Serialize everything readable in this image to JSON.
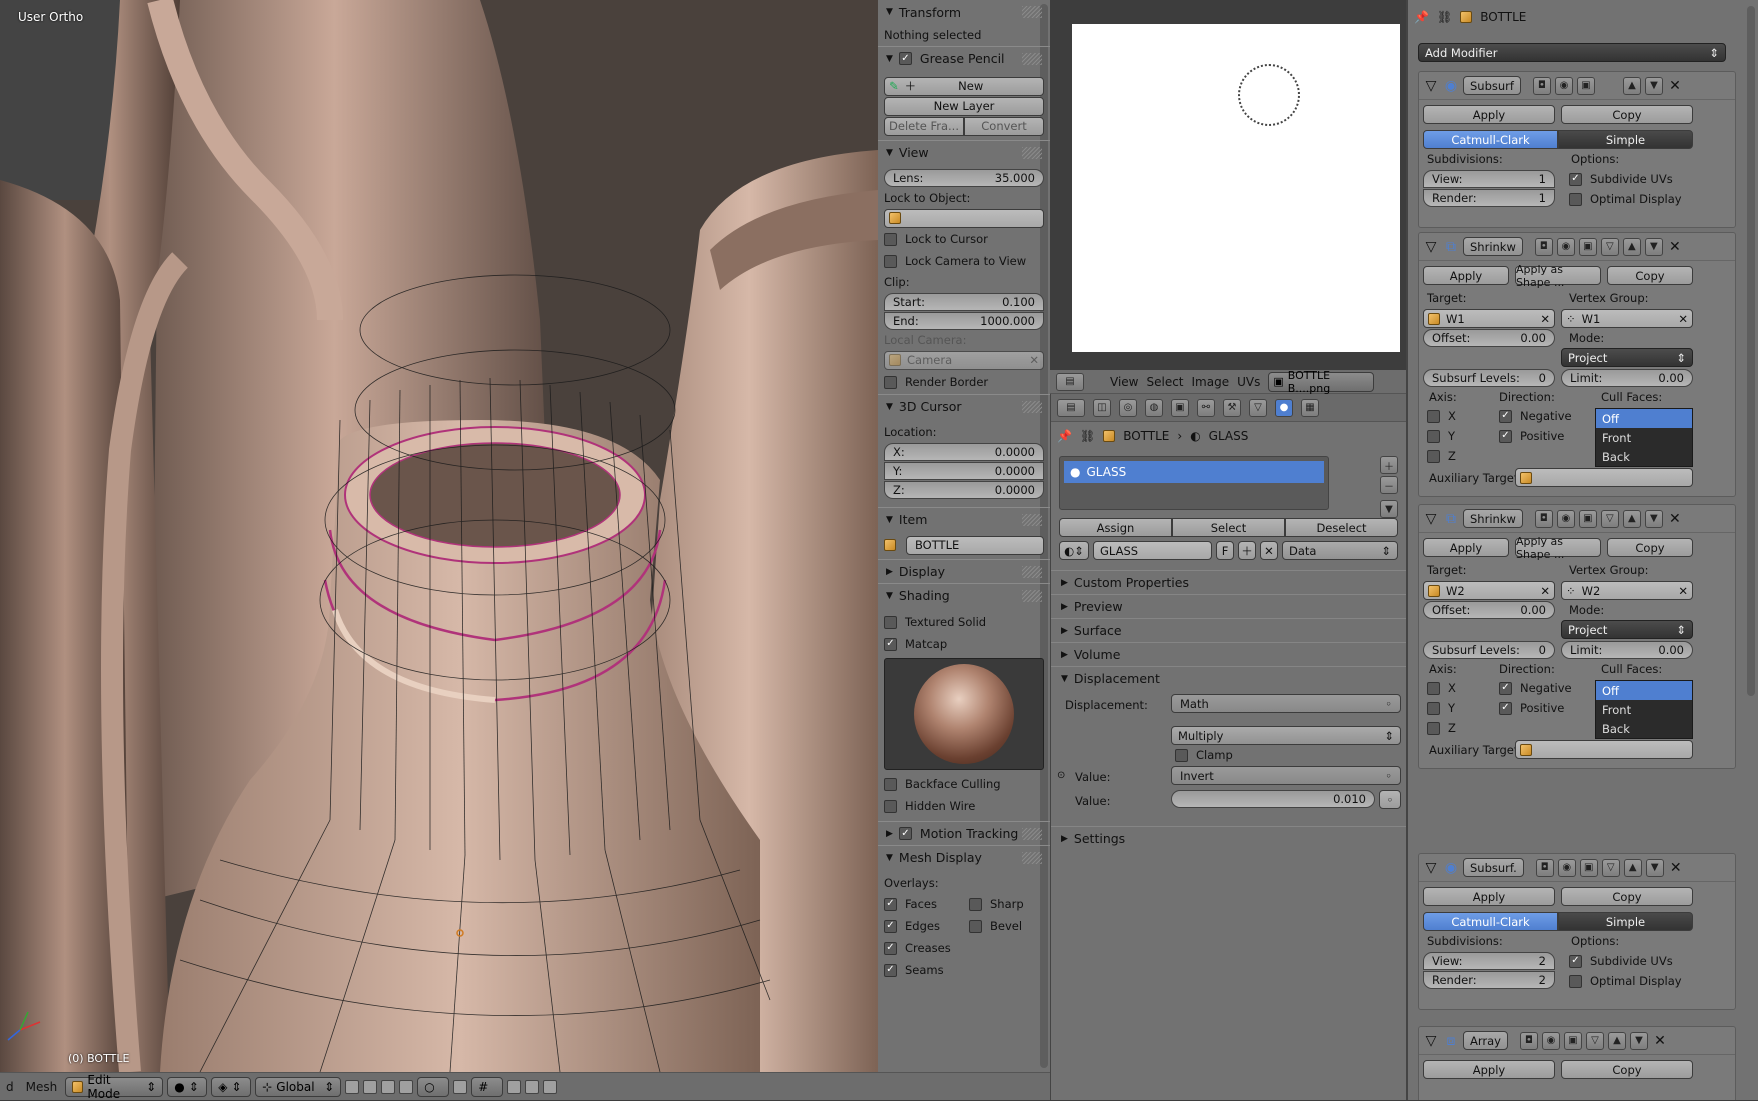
{
  "viewport": {
    "view_label": "User Ortho",
    "object_label": "(0) BOTTLE"
  },
  "header3d": {
    "cut_label": "d",
    "mesh_menu": "Mesh",
    "mode": "Edit Mode",
    "orientation": "Global"
  },
  "npanel": {
    "transform": "Transform",
    "nothing_selected": "Nothing selected",
    "grease_pencil": "Grease Pencil",
    "gp_new": "New",
    "gp_new_layer": "New Layer",
    "gp_delete_frame": "Delete Fra...",
    "gp_convert": "Convert",
    "view": "View",
    "lens_label": "Lens:",
    "lens_value": "35.000",
    "lock_to_object": "Lock to Object:",
    "lock_to_cursor": "Lock to Cursor",
    "lock_camera": "Lock Camera to View",
    "clip": "Clip:",
    "clip_start_label": "Start:",
    "clip_start": "0.100",
    "clip_end_label": "End:",
    "clip_end": "1000.000",
    "local_camera": "Local Camera:",
    "camera": "Camera",
    "render_border": "Render Border",
    "cursor3d": "3D Cursor",
    "location": "Location:",
    "x_label": "X:",
    "x": "0.0000",
    "y_label": "Y:",
    "y": "0.0000",
    "z_label": "Z:",
    "z": "0.0000",
    "item": "Item",
    "item_name": "BOTTLE",
    "display": "Display",
    "shading": "Shading",
    "textured_solid": "Textured Solid",
    "matcap": "Matcap",
    "backface_culling": "Backface Culling",
    "hidden_wire": "Hidden Wire",
    "motion_tracking": "Motion Tracking",
    "mesh_display": "Mesh Display",
    "overlays": "Overlays:",
    "faces": "Faces",
    "sharp": "Sharp",
    "edges": "Edges",
    "bevel": "Bevel",
    "creases": "Creases",
    "seams": "Seams"
  },
  "image_editor": {
    "menu": [
      "View",
      "Select",
      "Image",
      "UVs"
    ],
    "image_name": "BOTTLE B....png"
  },
  "material": {
    "crumb_object": "BOTTLE",
    "crumb_material": "GLASS",
    "slot_name": "GLASS",
    "assign": "Assign",
    "select": "Select",
    "deselect": "Deselect",
    "mat_name": "GLASS",
    "f_label": "F",
    "link": "Data",
    "sections": [
      "Custom Properties",
      "Preview",
      "Surface",
      "Volume"
    ],
    "displacement": "Displacement",
    "disp_label": "Displacement:",
    "disp_node": "Math",
    "operation": "Multiply",
    "clamp": "Clamp",
    "value1_label": "Value:",
    "value1": "Invert",
    "value2_label": "Value:",
    "value2": "0.010",
    "settings": "Settings"
  },
  "modifiers": {
    "crumb": "BOTTLE",
    "add_modifier": "Add Modifier",
    "apply": "Apply",
    "copy": "Copy",
    "apply_as_shape": "Apply as Shape ...",
    "catmull": "Catmull-Clark",
    "simple": "Simple",
    "subdivisions": "Subdivisions:",
    "options": "Options:",
    "view_label": "View:",
    "render_label": "Render:",
    "subdivide_uvs": "Subdivide UVs",
    "optimal_display": "Optimal Display",
    "target": "Target:",
    "vertex_group": "Vertex Group:",
    "offset_label": "Offset:",
    "mode": "Mode:",
    "project": "Project",
    "subsurf_levels": "Subsurf Levels:",
    "limit_label": "Limit:",
    "axis": "Axis:",
    "direction": "Direction:",
    "cull_faces": "Cull Faces:",
    "x": "X",
    "y": "Y",
    "z": "Z",
    "negative": "Negative",
    "positive": "Positive",
    "cull_off": "Off",
    "cull_front": "Front",
    "cull_back": "Back",
    "aux_target": "Auxiliary Target:",
    "subsurf1": {
      "name": "Subsurf",
      "view": "1",
      "render": "1"
    },
    "shrink1": {
      "name": "Shrinkw",
      "target": "W1",
      "vgroup": "W1",
      "offset": "0.00",
      "levels": "0",
      "limit": "0.00"
    },
    "shrink2": {
      "name": "Shrinkw",
      "target": "W2",
      "vgroup": "W2",
      "offset": "0.00",
      "levels": "0",
      "limit": "0.00"
    },
    "subsurf2": {
      "name": "Subsurf.",
      "view": "2",
      "render": "2"
    },
    "array": {
      "name": "Array"
    }
  }
}
